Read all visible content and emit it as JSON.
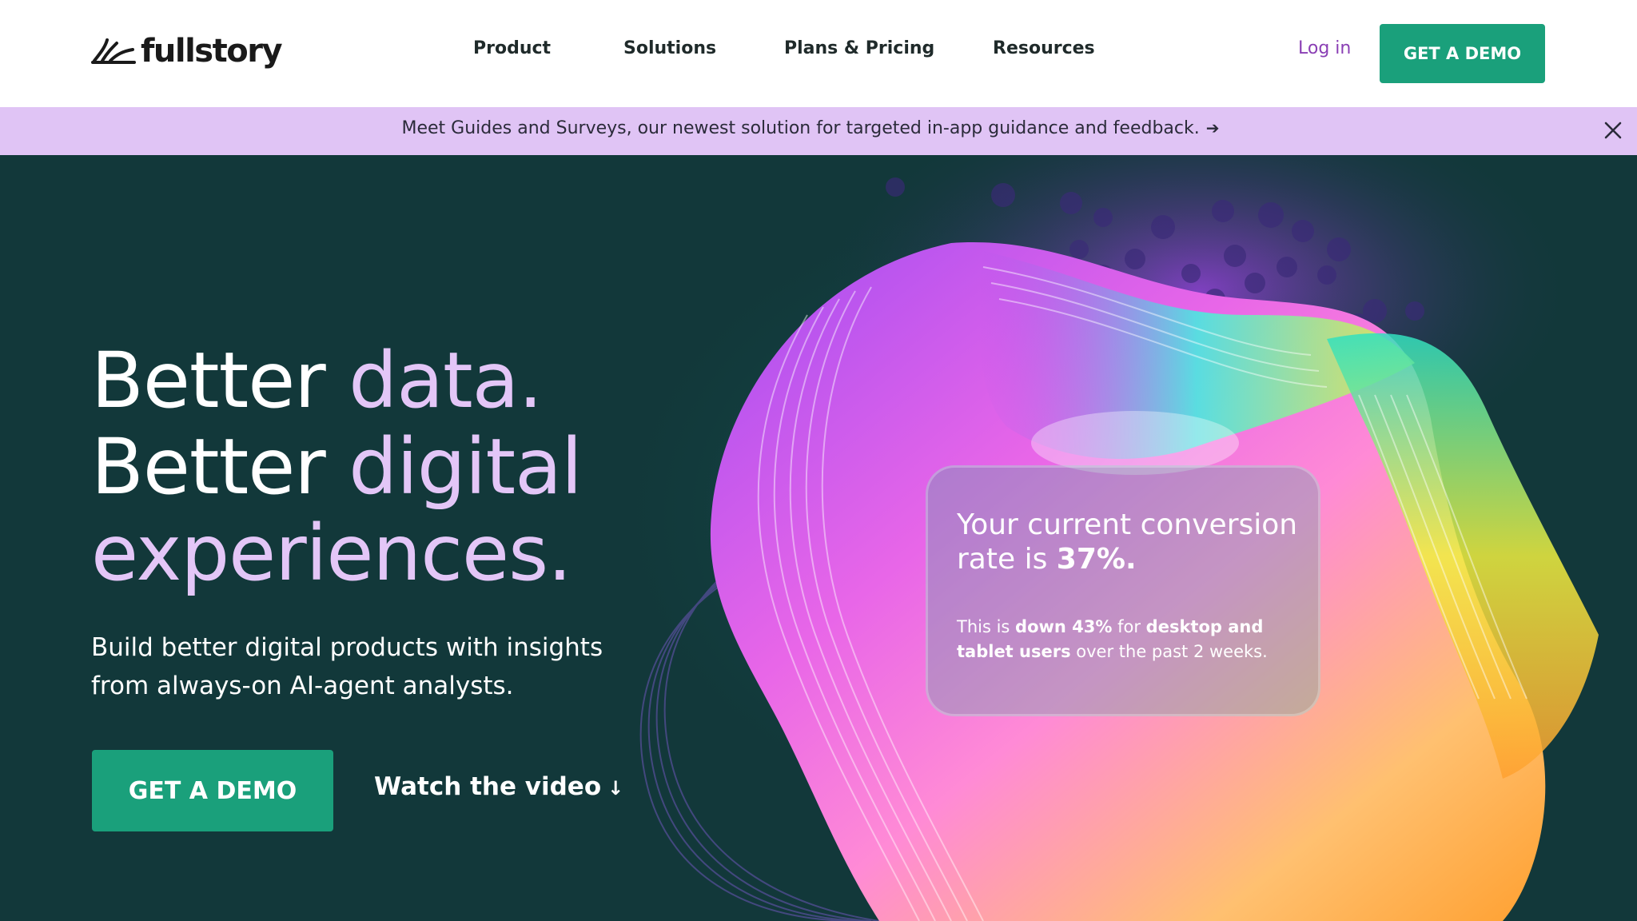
{
  "nav": {
    "logo_text": "fullstory",
    "links": [
      "Product",
      "Solutions",
      "Plans & Pricing",
      "Resources"
    ],
    "login": "Log in",
    "cta": "GET A DEMO"
  },
  "banner": {
    "text": "Meet Guides and Surveys, our newest solution for targeted in-app guidance and feedback.",
    "arrow": "➔"
  },
  "hero": {
    "headline_1a": "Better ",
    "headline_1b": "data.",
    "headline_2a": "Better ",
    "headline_2b": "digital",
    "headline_3": "experiences.",
    "subtitle": "Build better digital products with insights from always-on AI-agent analysts.",
    "cta": "GET A DEMO",
    "watch": "Watch the video",
    "watch_arrow": "↓"
  },
  "card": {
    "title_a": "Your current conversion rate is ",
    "title_b": "37%.",
    "body_1": "This is ",
    "body_2": "down 43%",
    "body_3": " for ",
    "body_4": "desktop and tablet users",
    "body_5": " over the past 2 weeks."
  },
  "colors": {
    "brand_green": "#1aa07b",
    "hero_bg": "#12383a",
    "banner_bg": "#e0c4f5",
    "accent_purple": "#e3c6f7",
    "login_purple": "#8a3fb4"
  },
  "icons": [
    "fullstory-logo-icon",
    "close-icon",
    "arrow-right-icon",
    "arrow-down-icon"
  ]
}
